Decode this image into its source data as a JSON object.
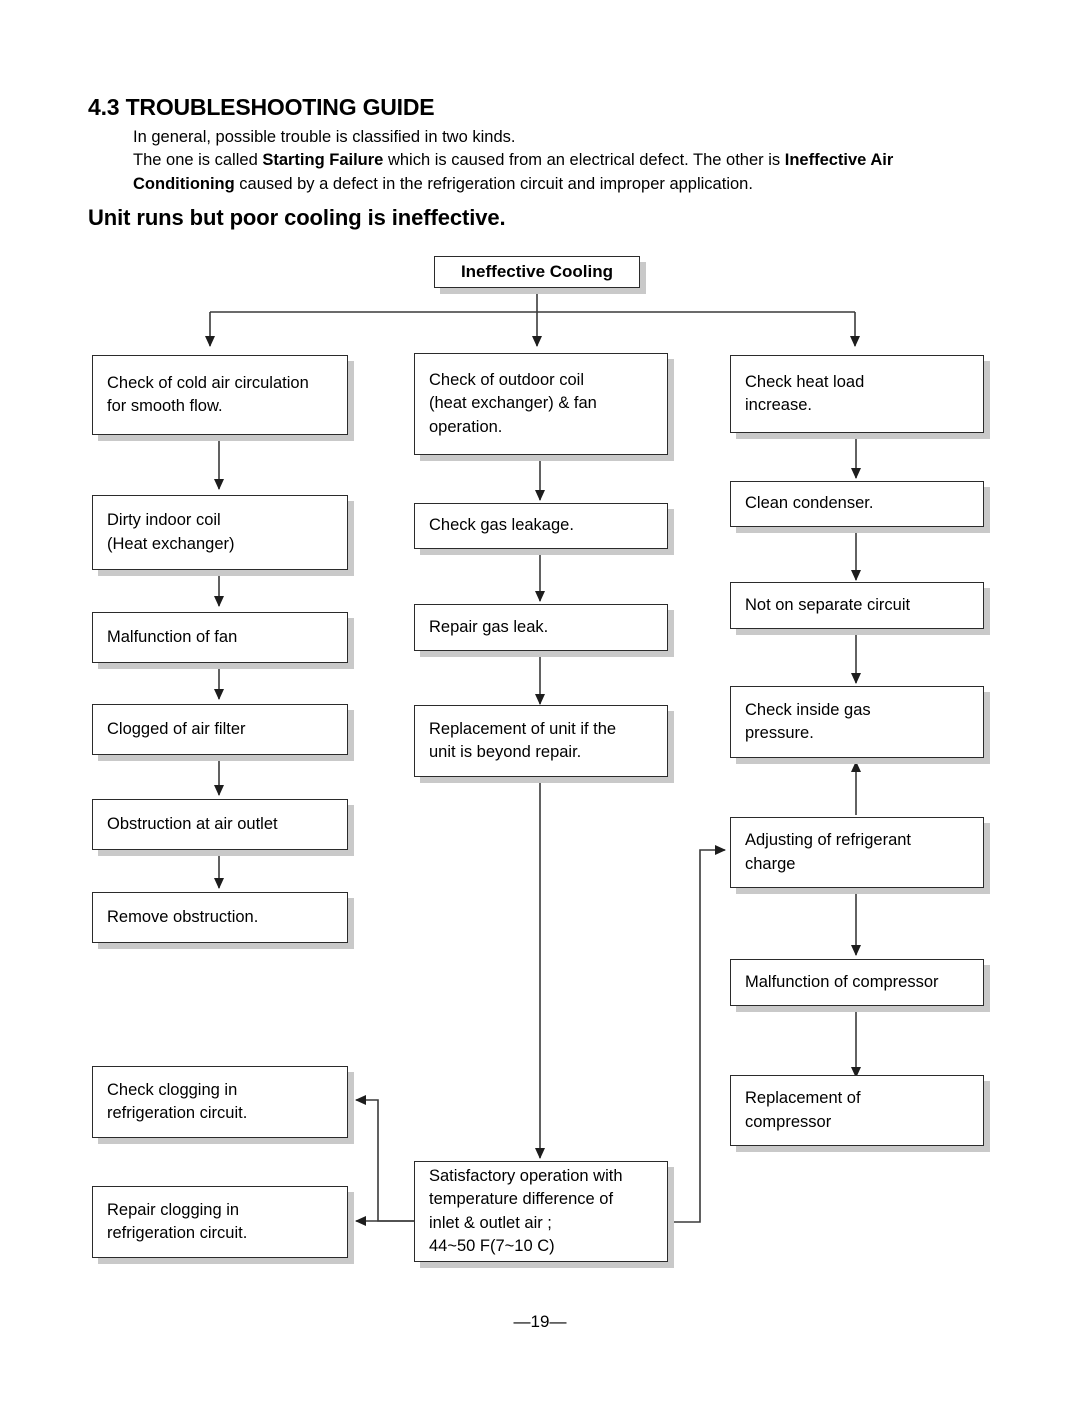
{
  "document": {
    "section_number_title": "4.3 TROUBLESHOOTING GUIDE",
    "intro_line_1": "In general, possible trouble is classified in two kinds.",
    "intro_line_2_a": "The one is called ",
    "intro_line_2_b": "Starting Failure",
    "intro_line_2_c": " which is caused from an electrical defect. The other is ",
    "intro_line_2_d": "Ineffective Air Conditioning",
    "intro_line_2_e": " caused by a defect in the refrigeration circuit and improper application.",
    "subtitle": "Unit runs but poor cooling is ineffective.",
    "page_footer": "—19—"
  },
  "flowchart": {
    "root": "Ineffective Cooling",
    "column_left": [
      "Check of cold  air circulation\n for smooth flow.",
      "Dirty indoor coil\n(Heat exchanger)",
      "Malfunction of fan",
      "Clogged of air filter",
      "Obstruction at air outlet",
      "Remove obstruction."
    ],
    "column_left_bottom": [
      "Check clogging in\nrefrigeration circuit.",
      "Repair clogging in\nrefrigeration circuit."
    ],
    "column_center": [
      "Check of outdoor coil\n(heat exchanger) & fan\noperation.",
      "Check gas leakage.",
      "Repair gas leak.",
      "Replacement of unit if the\nunit is beyond repair."
    ],
    "column_center_bottom": "Satisfactory operation with\ntemperature difference of\ninlet & outlet air ;\n44~50 F(7~10 C)",
    "column_right": [
      "Check heat load\nincrease.",
      "Clean condenser.",
      "Not on separate circuit",
      "Check inside gas\npressure.",
      "Adjusting of refrigerant\ncharge",
      "Malfunction of compressor",
      "Replacement of\ncompressor"
    ],
    "colors": {
      "line": "#3a3a3a",
      "box_border": "#2b2b2b",
      "box_shadow": "#c9c9c9",
      "text": "#000000",
      "background": "#ffffff"
    }
  }
}
